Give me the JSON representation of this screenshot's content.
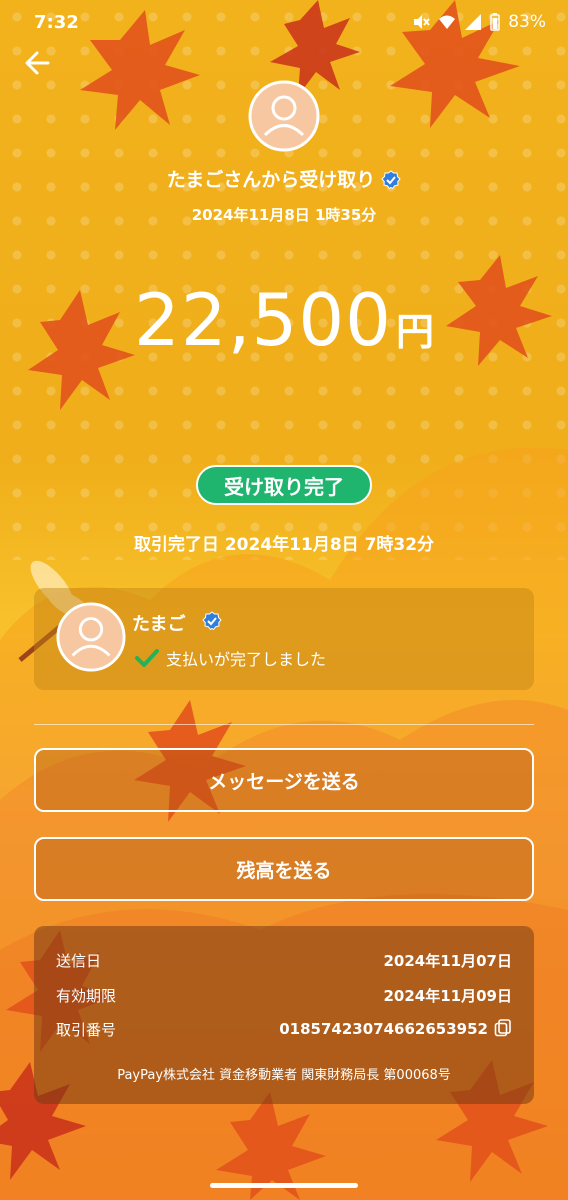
{
  "status_bar": {
    "time": "7:32",
    "battery": "83%",
    "icons": [
      "mute-icon",
      "wifi-icon",
      "signal-icon",
      "battery-icon"
    ]
  },
  "header": {
    "title": "たまごさんから受け取り",
    "datetime": "2024年11月8日 1時35分"
  },
  "amount": {
    "value": "22,500",
    "currency": "円"
  },
  "status": {
    "label": "受け取り完了",
    "complete_datetime": "取引完了日 2024年11月8日 7時32分"
  },
  "sender_card": {
    "name": "たまご",
    "message": "支払いが完了しました"
  },
  "actions": {
    "message_button": "メッセージを送る",
    "send_balance_button": "残高を送る"
  },
  "info": {
    "rows": [
      {
        "label": "送信日",
        "value": "2024年11月07日"
      },
      {
        "label": "有効期限",
        "value": "2024年11月09日"
      },
      {
        "label": "取引番号",
        "value": "01857423074662653952"
      }
    ],
    "footer": "PayPay株式会社 資金移動業者 関東財務局長 第00068号"
  },
  "colors": {
    "accent_green": "#1fb56f",
    "verified_blue": "#2f7fe0",
    "avatar_peach": "#f6c7a0"
  }
}
